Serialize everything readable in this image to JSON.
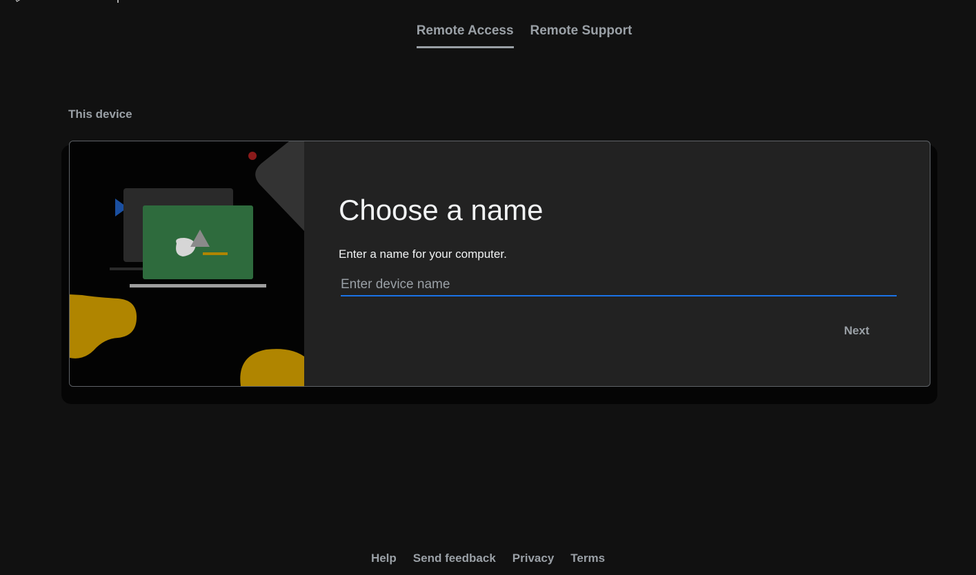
{
  "tabs": [
    {
      "label": "Remote Access",
      "active": true
    },
    {
      "label": "Remote Support",
      "active": false
    }
  ],
  "section": {
    "label": "This device"
  },
  "setup_card": {
    "heading": "Choose a name",
    "subtext": "Enter a name for your computer.",
    "input_placeholder": "Enter device name",
    "input_value": "",
    "next_label": "Next"
  },
  "footer": {
    "links": [
      "Help",
      "Send feedback",
      "Privacy",
      "Terms"
    ]
  },
  "colors": {
    "background": "#111111",
    "card": "#222222",
    "input_underline": "#1a73e8",
    "illustration_green": "#2e6b3d",
    "illustration_yellow": "#b08500",
    "illustration_blue": "#1a4fa0",
    "illustration_red": "#8b1a1a"
  }
}
